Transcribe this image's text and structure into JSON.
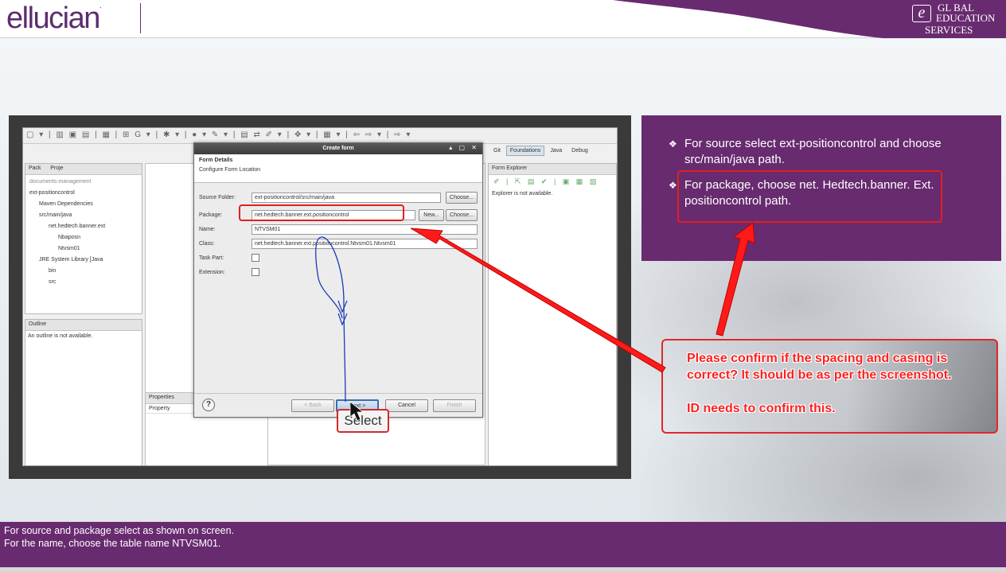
{
  "brand": {
    "logo_text": "ellucian",
    "logo_mark": ".",
    "partner_line1": "GL  BAL",
    "partner_line2": "EDUCATION",
    "partner_line3": "SERVICES",
    "partner_mark": "e"
  },
  "colors": {
    "purple": "#682b6f",
    "callout_red": "#e02828"
  },
  "screenshot": {
    "toolbar_icons": "▢ ▾ | ▥ ▣ ▤ | ▦ | ⊞ G ▾ | ✱ ▾ | ● ▾ ✎ ▾ | ▤ ⇄ ✐ ▾ | ✥ ▾ | ▦ ▾ | ⇦ ⇨ ▾ | ⇨ ▾",
    "package_panel": {
      "tab1": "Pack",
      "tab2": "Proje",
      "tree": [
        "documents-management",
        "ext-positioncontrol",
        "Maven Dependencies",
        "src/main/java",
        "net.hedtech.banner.ext",
        "Nbaposn",
        "Ntvsm01",
        "JRE System Library [Java",
        "bin",
        "src"
      ]
    },
    "outline_panel": {
      "tab": "Outline",
      "message": "An outline is not available."
    },
    "properties_panel": {
      "tab": "Properties",
      "column": "Property"
    },
    "perspectives": {
      "git": "Git",
      "foundations": "Foundations",
      "java": "Java",
      "debug": "Debug"
    },
    "form_explorer": {
      "tab": "Form Explorer",
      "icons": "✐ | ⇱ ▤ ✔ | ▣ ▦ ▧",
      "message": "Explorer is not available."
    },
    "dialog": {
      "title": "Create form",
      "header_title": "Form Details",
      "header_subtitle": "Configure Form Location",
      "source_folder_label": "Source Folder:",
      "source_folder_value": "ext-positioncontrol/src/main/java",
      "package_label": "Package:",
      "package_value": "net.hedtech.banner.ext.positioncontrol",
      "name_label": "Name:",
      "name_value": "NTVSM01",
      "class_label": "Class:",
      "class_value": "net.hedtech.banner.ext.positioncontrol.Ntvsm01.Ntvsm01",
      "task_part_label": "Task Part:",
      "extension_label": "Extension:",
      "choose_label": "Choose...",
      "new_label": "New...",
      "help_label": "?",
      "back_label": "< Back",
      "next_label": "Next >",
      "cancel_label": "Cancel",
      "finish_label": "Finish"
    },
    "select_annotation": "Select"
  },
  "info_panel": {
    "bullet_glyph": "❖",
    "items": [
      "For source select ext-positioncontrol and choose src/main/java path.",
      "For package, choose net. Hedtech.banner. Ext. positioncontrol path."
    ]
  },
  "callout": {
    "line1": "Please confirm if the spacing and casing is correct? It should be as per the screenshot.",
    "line2": "ID needs to confirm this."
  },
  "footer": {
    "line1": "For source and package select as shown on screen.",
    "line2": "For the name, choose the table name NTVSM01."
  }
}
